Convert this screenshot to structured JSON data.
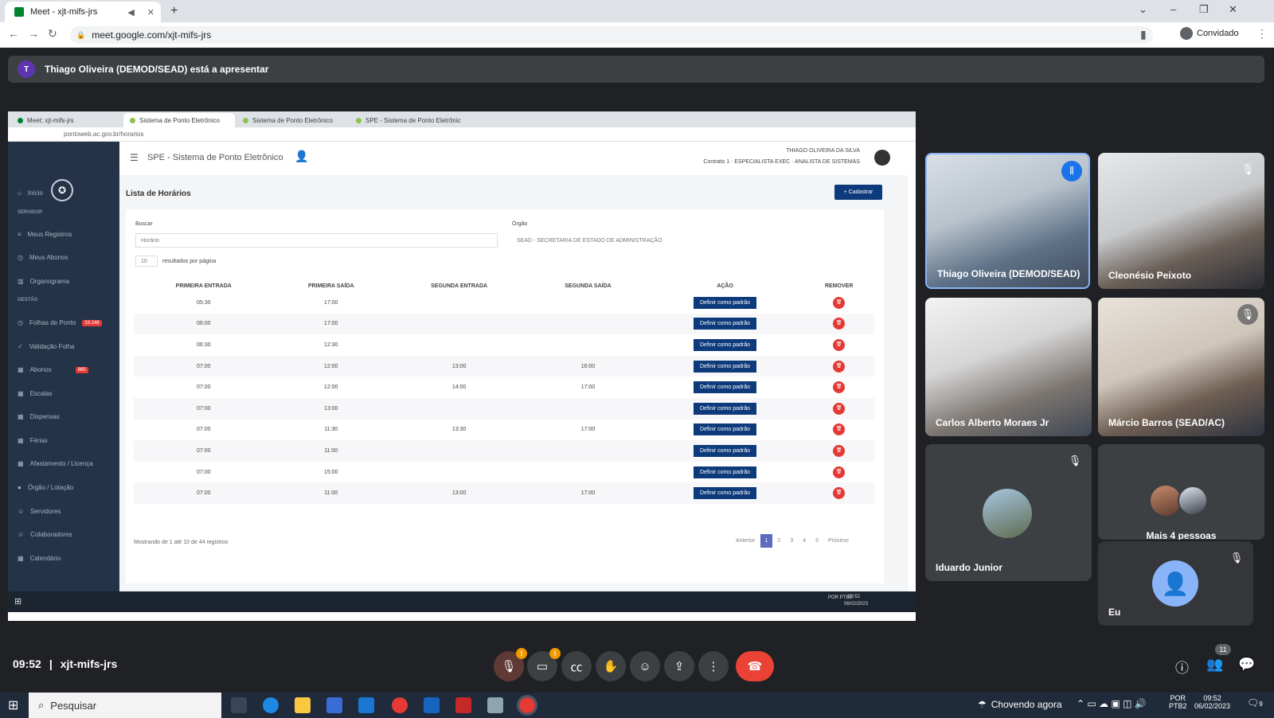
{
  "browser": {
    "tab_title": "Meet - xjt-mifs-jrs",
    "new_tab": "+",
    "url": "meet.google.com/xjt-mifs-jrs",
    "profile": "Convidado"
  },
  "presenting_banner": {
    "avatar_letter": "T",
    "text": "Thiago Oliveira (DEMOD/SEAD) está a apresentar"
  },
  "shared": {
    "tabs": [
      "Meet: xjt-mifs-jrs",
      "Sistema de Ponto Eletrônico",
      "Sistema de Ponto Eletrônico",
      "SPE - Sistema de Ponto Eletrônic"
    ],
    "url": "pontoweb.ac.gov.br/horarios",
    "app_title": "SPE - Sistema de Ponto Eletrônico",
    "user_name": "THIAGO OLIVEIRA DA SILVA",
    "user_contract": "Contrato 1 · ESPECIALISTA EXEC · ANALISTA DE SISTEMAS",
    "sidebar": {
      "inicio": "Início",
      "section_servidor": "SERVIDOR",
      "meus_registros": "Meus Registros",
      "meus_abonos": "Meus Abonos",
      "organograma": "Organograma",
      "section_gestao": "GESTÃO",
      "folhas": "Folhas de Ponto",
      "folhas_badge": "33.248",
      "validacao": "Validação Folha",
      "abonos": "Abonos",
      "abonos_badge": "885",
      "escalas": "Escalas",
      "dispensas": "Dispensas",
      "ferias": "Férias",
      "afastamento": "Afastamento / Licença",
      "orgao_lotacao": "Órgão / Lotação",
      "servidores": "Servidores",
      "colaboradores": "Colaboradores",
      "calendario": "Calendário"
    },
    "page_title": "Lista de Horários",
    "cadastrar": "+ Cadastrar",
    "buscar_label": "Buscar",
    "buscar_placeholder": "Horário",
    "orgao_label": "Órgão",
    "orgao_value": "SEAD - SECRETARIA DE ESTADO DE ADMINISTRAÇÃO",
    "per_page_value": "10",
    "per_page_label": "resultados por página",
    "columns": [
      "PRIMEIRA ENTRADA",
      "PRIMEIRA SAÍDA",
      "SEGUNDA ENTRADA",
      "SEGUNDA SAÍDA",
      "AÇÃO",
      "REMOVER"
    ],
    "action_label": "Definir como padrão",
    "rows": [
      [
        "05:30",
        "17:00",
        "",
        ""
      ],
      [
        "06:00",
        "17:00",
        "",
        ""
      ],
      [
        "06:30",
        "12:30",
        "",
        ""
      ],
      [
        "07:00",
        "12:00",
        "13:00",
        "16:00"
      ],
      [
        "07:00",
        "12:00",
        "14:00",
        "17:00"
      ],
      [
        "07:00",
        "13:00",
        "",
        ""
      ],
      [
        "07:00",
        "11:30",
        "13:30",
        "17:00"
      ],
      [
        "07:00",
        "11:00",
        "",
        ""
      ],
      [
        "07:00",
        "15:00",
        "",
        ""
      ],
      [
        "07:00",
        "11:00",
        "13:00",
        "17:00"
      ]
    ],
    "showing": "Mostrando de 1 até 10 de 44 registros",
    "pager": {
      "prev": "Anterior",
      "pages": [
        "1",
        "2",
        "3",
        "4",
        "5"
      ],
      "next": "Próximo"
    },
    "taskbar_time": "09:52",
    "taskbar_date": "06/02/2023",
    "taskbar_lang": "POR PTB2"
  },
  "participants": {
    "p1": "Thiago Oliveira (DEMOD/SEAD)",
    "p2": "Cleonésio Peixoto",
    "p3": "Carlos Alberto Moraes Jr",
    "p4": "Márcio Barros (SEAD/AC)",
    "p5": "Iduardo Junior",
    "more": "Mais 4 pessoas",
    "me": "Eu"
  },
  "meet_bar": {
    "time": "09:52",
    "separator": "|",
    "code": "xjt-mifs-jrs",
    "people_count": "11"
  },
  "windows_taskbar": {
    "search": "Pesquisar",
    "weather": "Chovendo agora",
    "lang1": "POR",
    "lang2": "PTB2",
    "time": "09:52",
    "date": "06/02/2023",
    "notif": "9"
  },
  "colors": {
    "meet_bg": "#202124",
    "tile": "#3c4043",
    "hangup": "#ea4335",
    "spe_primary": "#0d3a7a",
    "spe_sidebar": "#243347"
  }
}
